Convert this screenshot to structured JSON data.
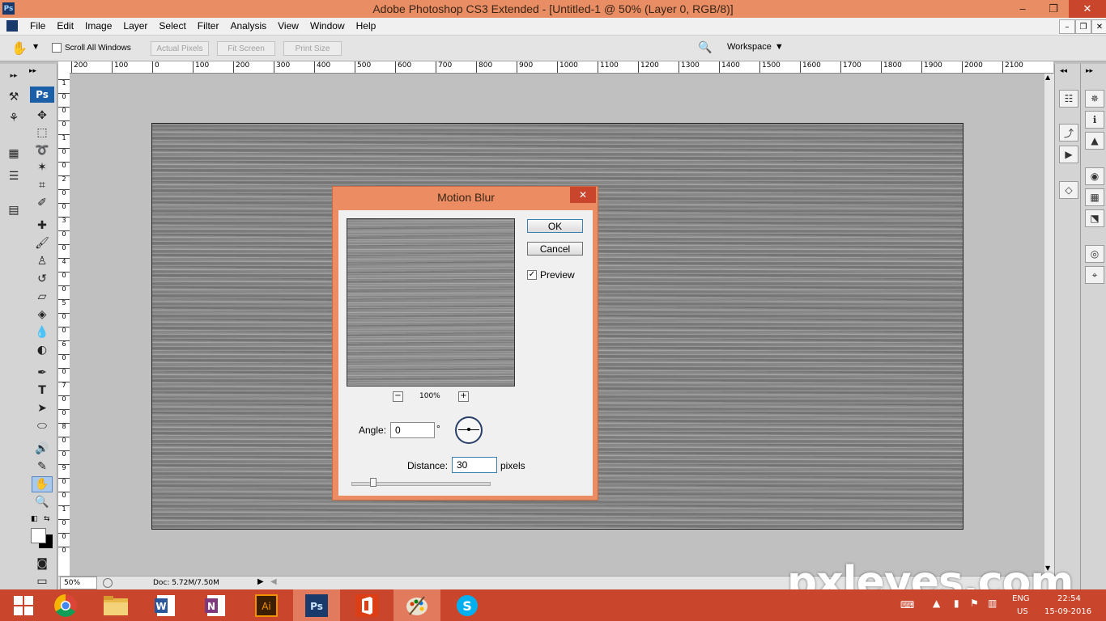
{
  "window": {
    "title": "Adobe Photoshop CS3 Extended - [Untitled-1 @ 50% (Layer 0, RGB/8)]",
    "app_icon": "Ps"
  },
  "menu": [
    "File",
    "Edit",
    "Image",
    "Layer",
    "Select",
    "Filter",
    "Analysis",
    "View",
    "Window",
    "Help"
  ],
  "options_bar": {
    "scroll_all_windows": "Scroll All Windows",
    "actual_pixels": "Actual Pixels",
    "fit_screen": "Fit Screen",
    "print_size": "Print Size",
    "workspace": "Workspace"
  },
  "toolbox_header": "Ps",
  "ruler_top": [
    "200",
    "100",
    "0",
    "100",
    "200",
    "300",
    "400",
    "500",
    "600",
    "700",
    "800",
    "900",
    "1000",
    "1100",
    "1200",
    "1300",
    "1400",
    "1500",
    "1600",
    "1700",
    "1800",
    "1900",
    "2000",
    "2100"
  ],
  "ruler_left": [
    "1",
    "0",
    "0",
    "0",
    "1",
    "0",
    "0",
    "2",
    "0",
    "0",
    "3",
    "0",
    "0",
    "4",
    "0",
    "0",
    "5",
    "0",
    "0",
    "6",
    "0",
    "0",
    "7",
    "0",
    "0",
    "8",
    "0",
    "0",
    "9",
    "0",
    "0",
    "1",
    "0",
    "0",
    "0"
  ],
  "status": {
    "zoom": "50%",
    "doc": "Doc: 5.72M/7.50M"
  },
  "dialog": {
    "title": "Motion Blur",
    "ok": "OK",
    "cancel": "Cancel",
    "preview_label": "Preview",
    "preview_checked": true,
    "zoom": "100%",
    "zoom_minus": "−",
    "zoom_plus": "+",
    "angle_label": "Angle:",
    "angle_value": "0",
    "degree": "°",
    "distance_label": "Distance:",
    "distance_value": "30",
    "distance_unit": "pixels"
  },
  "taskbar": {
    "lang": "ENG",
    "region": "US",
    "time": "22:54",
    "date": "15-09-2016"
  },
  "watermark": "pxleyes.com",
  "colors": {
    "titlebar": "#e98e64",
    "taskbar": "#c9452b",
    "close": "#c9452b"
  }
}
